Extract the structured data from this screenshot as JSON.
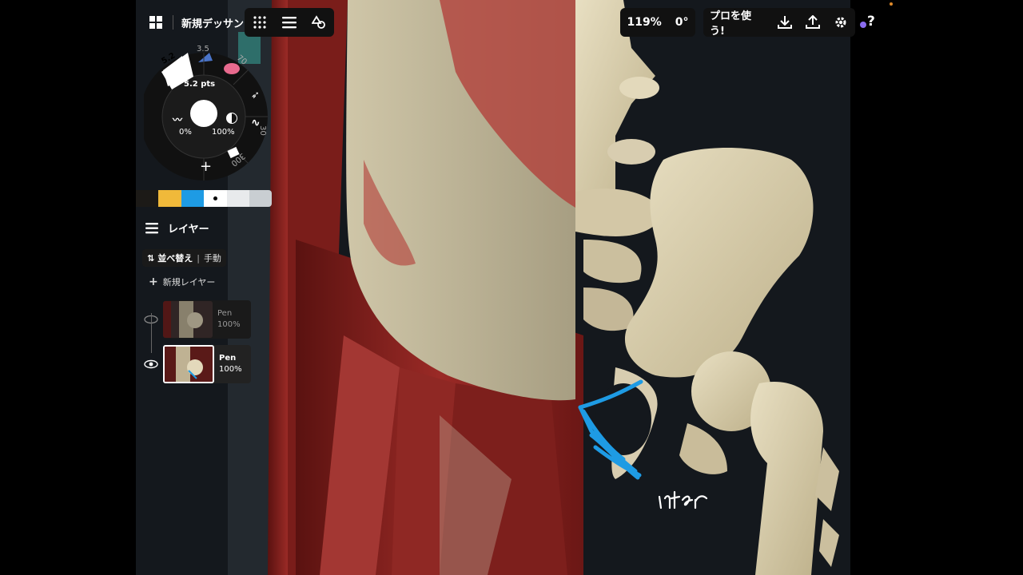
{
  "app": {
    "doc_title": "新規デッサン",
    "zoom": "119%",
    "rotation": "0°",
    "pro_label": "プロを使う!",
    "help": "?"
  },
  "icons": {
    "gallery": "grid-icon",
    "palette": "dots-grid-icon",
    "layers": "layers-stack-icon",
    "shapes": "shapes-icon",
    "download": "download-icon",
    "upload": "upload-icon",
    "settings": "gear-icon",
    "undo": "undo-icon",
    "redo": "redo-icon"
  },
  "brush_wheel": {
    "size_top": "5.2",
    "size_slot2": "3.5",
    "size_slot3": "70",
    "size_slot_right": "30",
    "size_slot_bottom": "300",
    "size_readout": "5.2 pts",
    "smoothing": "0%",
    "opacity": "100%",
    "add": "+"
  },
  "swatches": [
    "#1c1a17",
    "#f0b93a",
    "#1e9be4",
    "#ffffff",
    "#e8eaec",
    "#c9ced2"
  ],
  "layers_panel": {
    "title": "レイヤー",
    "sort_label": "並べ替え",
    "sort_mode": "手動",
    "new_layer": "新規レイヤー",
    "items": [
      {
        "name": "Pen",
        "opacity": "100%",
        "visible": false
      },
      {
        "name": "Pen",
        "opacity": "100%",
        "visible": true
      }
    ]
  },
  "canvas": {
    "annotation": "infer",
    "stroke_color": "#1e9be4"
  }
}
